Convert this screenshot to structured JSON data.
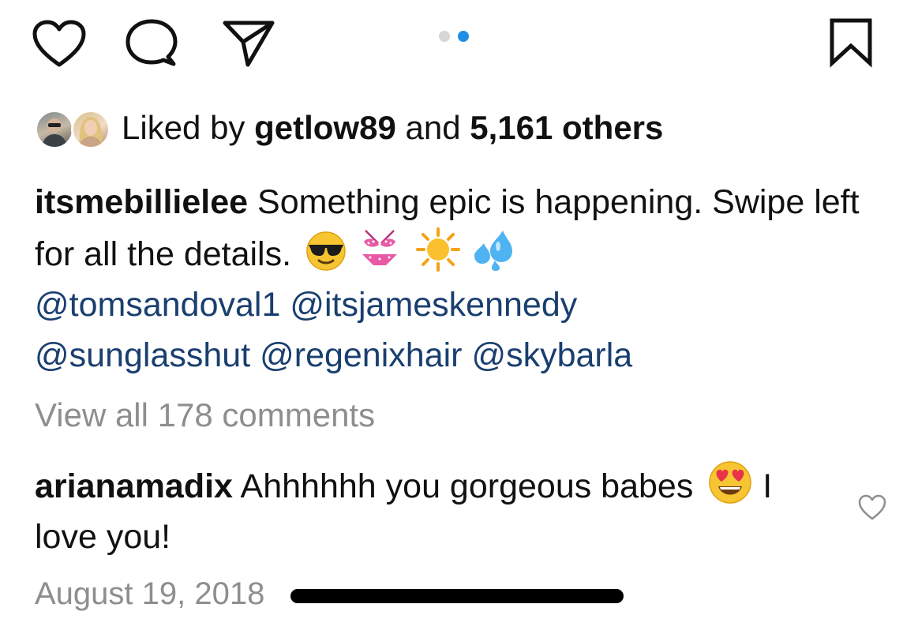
{
  "action_bar": {
    "icons": [
      "heart-icon",
      "comment-icon",
      "share-icon",
      "bookmark-icon"
    ],
    "carousel_dots": 2,
    "active_dot": 2,
    "accent_color": "#1f8fe6"
  },
  "likes": {
    "prefix": "Liked by ",
    "user": "getlow89",
    "middle": " and ",
    "count": "5,161 others"
  },
  "caption": {
    "user": "itsmebillielee",
    "text": " Something epic is happening. Swipe left for all the details.",
    "emojis": [
      "sunglasses-emoji",
      "bikini-emoji",
      "sun-emoji",
      "sweat-droplets-emoji"
    ],
    "mentions": [
      "@tomsandoval1",
      "@itsjameskennedy",
      "@sunglasshut",
      "@regenixhair",
      "@skybarla"
    ],
    "mention_color": "#1a3f6f"
  },
  "view_all": "View all 178 comments",
  "comment": {
    "user": "arianamadix",
    "text_before": " Ahhhhhh you gorgeous babes",
    "emoji": "heart-eyes-emoji",
    "text_after": "  I love you!"
  },
  "date": "August 19, 2018"
}
